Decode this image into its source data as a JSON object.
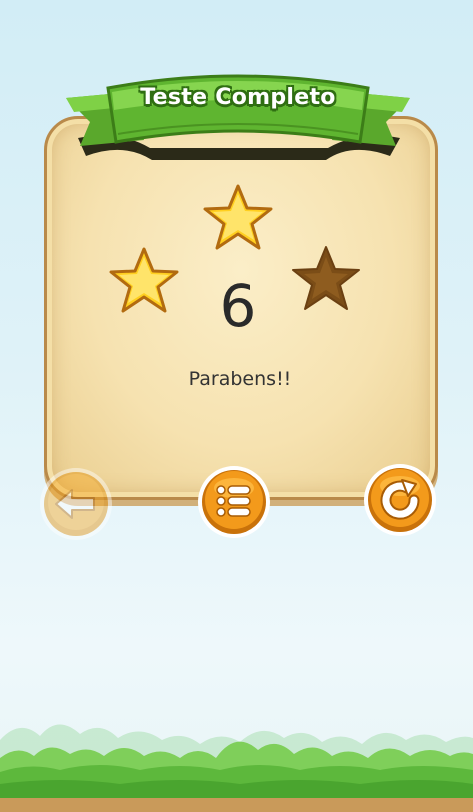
{
  "dialog": {
    "title": "Teste Completo",
    "score": "6",
    "message": "Parabens!!",
    "stars_earned": 2,
    "stars_total": 3
  },
  "buttons": [
    {
      "name": "back",
      "icon": "back-arrow-icon",
      "enabled": false
    },
    {
      "name": "menu",
      "icon": "list-icon",
      "enabled": true
    },
    {
      "name": "retry",
      "icon": "retry-icon",
      "enabled": true
    }
  ],
  "colors": {
    "banner_green": "#6cc03a",
    "star_gold": "#ffd020",
    "star_empty": "#8a5a1e",
    "button_orange": "#f39a1b",
    "card_parchment": "#f6e2b0"
  }
}
